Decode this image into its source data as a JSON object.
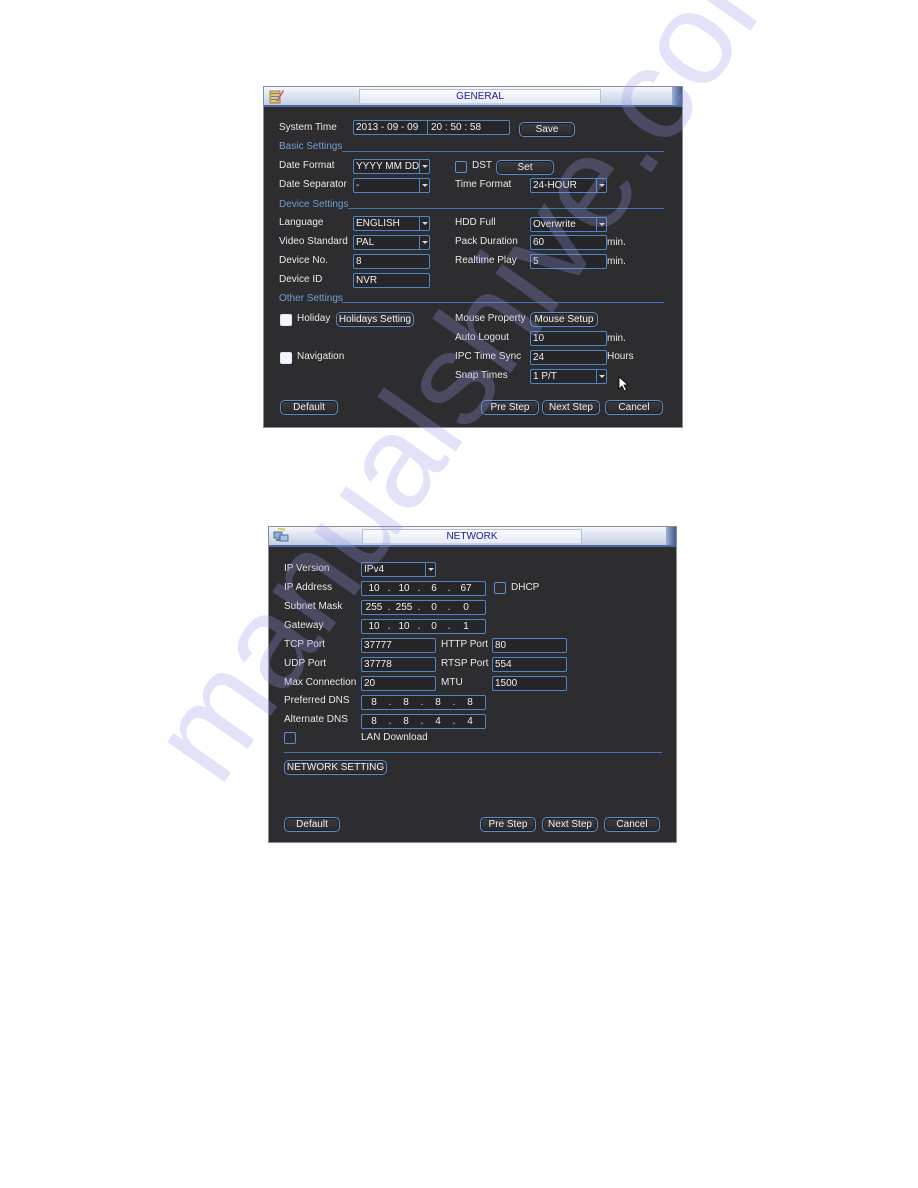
{
  "watermark": "manualshive.com",
  "general": {
    "title": "GENERAL",
    "system_time": {
      "label": "System Time",
      "date": "2013 - 09 - 09",
      "time": "20 : 50 : 58",
      "save_label": "Save"
    },
    "basic_settings": {
      "heading": "Basic Settings",
      "date_format_label": "Date Format",
      "date_format_value": "YYYY MM DD",
      "dst_label": "DST",
      "dst_checked": false,
      "set_label": "Set",
      "date_separator_label": "Date Separator",
      "date_separator_value": "-",
      "time_format_label": "Time Format",
      "time_format_value": "24-HOUR"
    },
    "device_settings": {
      "heading": "Device Settings",
      "language_label": "Language",
      "language_value": "ENGLISH",
      "hdd_full_label": "HDD Full",
      "hdd_full_value": "Overwrite",
      "video_standard_label": "Video Standard",
      "video_standard_value": "PAL",
      "pack_duration_label": "Pack Duration",
      "pack_duration_value": "60",
      "pack_duration_unit": "min.",
      "device_no_label": "Device No.",
      "device_no_value": "8",
      "realtime_play_label": "Realtime Play",
      "realtime_play_value": "5",
      "realtime_play_unit": "min.",
      "device_id_label": "Device ID",
      "device_id_value": "NVR"
    },
    "other_settings": {
      "heading": "Other Settings",
      "holiday_label": "Holiday",
      "holiday_checked": false,
      "holidays_setting_label": "Holidays Setting",
      "navigation_label": "Navigation",
      "navigation_checked": false,
      "mouse_property_label": "Mouse Property",
      "mouse_setup_label": "Mouse Setup",
      "auto_logout_label": "Auto Logout",
      "auto_logout_value": "10",
      "auto_logout_unit": "min.",
      "ipc_time_sync_label": "IPC Time Sync",
      "ipc_time_sync_value": "24",
      "ipc_time_sync_unit": "Hours",
      "snap_times_label": "Snap Times",
      "snap_times_value": "1 P/T"
    },
    "buttons": {
      "default": "Default",
      "pre_step": "Pre Step",
      "next_step": "Next Step",
      "cancel": "Cancel"
    }
  },
  "network": {
    "title": "NETWORK",
    "ip_version_label": "IP Version",
    "ip_version_value": "IPv4",
    "ip_address_label": "IP Address",
    "ip_address": [
      "10",
      "10",
      "6",
      "67"
    ],
    "dhcp_label": "DHCP",
    "dhcp_checked": false,
    "subnet_mask_label": "Subnet Mask",
    "subnet_mask": [
      "255",
      "255",
      "0",
      "0"
    ],
    "gateway_label": "Gateway",
    "gateway": [
      "10",
      "10",
      "0",
      "1"
    ],
    "tcp_port_label": "TCP Port",
    "tcp_port_value": "37777",
    "http_port_label": "HTTP Port",
    "http_port_value": "80",
    "udp_port_label": "UDP Port",
    "udp_port_value": "37778",
    "rtsp_port_label": "RTSP Port",
    "rtsp_port_value": "554",
    "max_connection_label": "Max Connection",
    "max_connection_value": "20",
    "mtu_label": "MTU",
    "mtu_value": "1500",
    "preferred_dns_label": "Preferred DNS",
    "preferred_dns": [
      "8",
      "8",
      "8",
      "8"
    ],
    "alternate_dns_label": "Alternate DNS",
    "alternate_dns": [
      "8",
      "8",
      "4",
      "4"
    ],
    "lan_download_label": "LAN Download",
    "lan_download_checked": false,
    "network_setting_label": "NETWORK SETTING",
    "buttons": {
      "default": "Default",
      "pre_step": "Pre Step",
      "next_step": "Next Step",
      "cancel": "Cancel"
    }
  }
}
